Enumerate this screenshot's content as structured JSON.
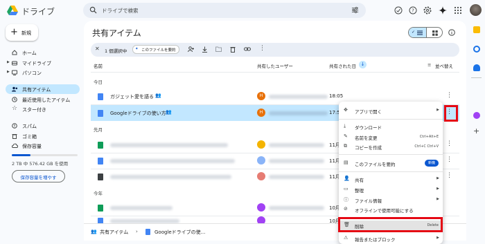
{
  "app": {
    "title": "ドライブ"
  },
  "search": {
    "placeholder": "ドライブで検索"
  },
  "header": {
    "icons": [
      "status-icon",
      "help-icon",
      "settings-icon",
      "gemini-icon",
      "apps-icon"
    ]
  },
  "sidebar": {
    "new_label": "新規",
    "items": [
      {
        "label": "ホーム",
        "icon": "home-icon"
      },
      {
        "label": "マイドライブ",
        "icon": "my-drive-icon"
      },
      {
        "label": "パソコン",
        "icon": "computer-icon"
      },
      {
        "label": "共有アイテム",
        "icon": "shared-icon",
        "active": true
      },
      {
        "label": "最近使用したアイテム",
        "icon": "recent-icon"
      },
      {
        "label": "スター付き",
        "icon": "star-icon"
      },
      {
        "label": "スパム",
        "icon": "spam-icon"
      },
      {
        "label": "ゴミ箱",
        "icon": "trash-icon"
      },
      {
        "label": "保存容量",
        "icon": "cloud-icon"
      }
    ],
    "storage_text": "2 TB 中 576.42 GB を使用",
    "storage_fraction": 0.28,
    "buy_storage_label": "保存容量を増やす"
  },
  "main": {
    "title": "共有アイテム",
    "selection": {
      "count_text": "1 個選択中",
      "summarize_label": "このファイルを要約"
    },
    "columns": {
      "name": "名前",
      "shared_by": "共有したユーザー",
      "shared_date": "共有された日",
      "sort": "並べ替え"
    },
    "sections": {
      "today": "今日",
      "last_month": "先月",
      "this_year": "今年"
    },
    "rows": [
      {
        "name": "ガジェット愛を語る",
        "avatar": "H",
        "date": "18:05"
      },
      {
        "name": "Googleドライブの使い方",
        "avatar": "H",
        "date": "17:5"
      }
    ],
    "partial_dates": [
      "11月",
      "11月",
      "11月",
      "10月",
      "10月"
    ]
  },
  "context_menu": {
    "open_with": "アプリで開く",
    "download": "ダウンロード",
    "rename": "名前を変更",
    "rename_shortcut": "Ctrl+Alt+E",
    "copy": "コピーを作成",
    "copy_shortcut": "Ctrl+C Ctrl+V",
    "summarize": "このファイルを要約",
    "new_badge": "新機",
    "share": "共有",
    "organize": "整理",
    "file_info": "ファイル情報",
    "offline": "オフラインで使用可能にする",
    "delete": "削除",
    "delete_shortcut": "Delete",
    "report": "報告またはブロック"
  },
  "breadcrumb": {
    "root": "共有アイテム",
    "file": "Googleドライブの使..."
  },
  "colors": {
    "accent": "#0b57d0",
    "selected_bg": "#c2e7ff",
    "highlight": "#e50914"
  }
}
